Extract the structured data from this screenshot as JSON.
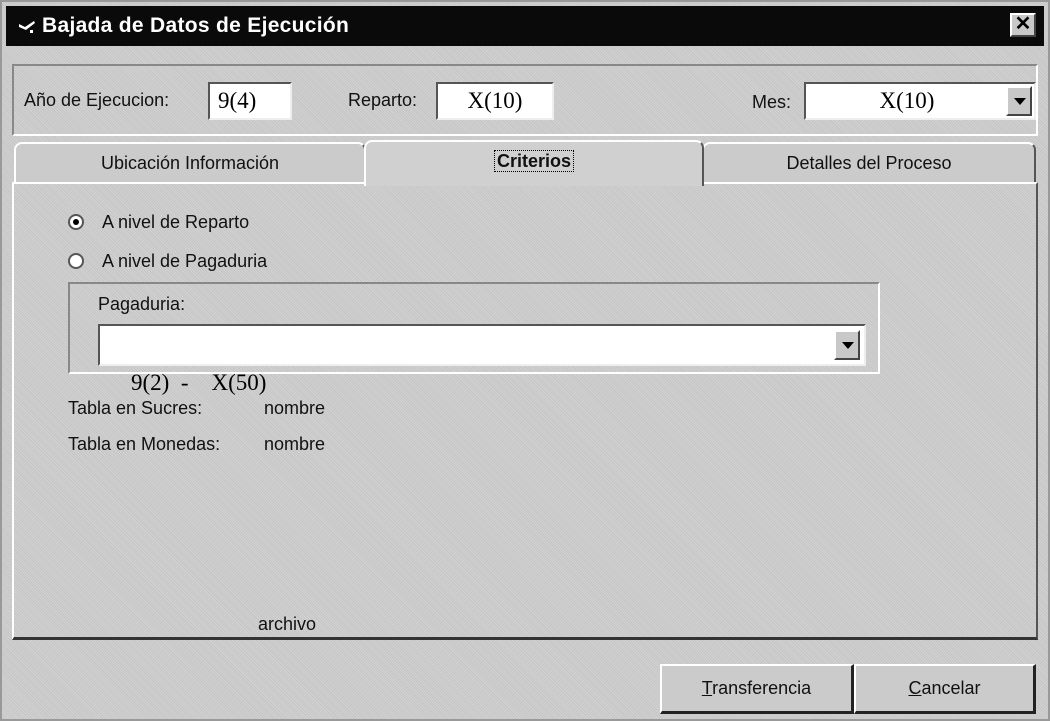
{
  "window": {
    "title": "Bajada de Datos de Ejecución",
    "close_glyph": "✕"
  },
  "header": {
    "anio_label": "Año de Ejecucion:",
    "anio_value": "9(4)",
    "reparto_label": "Reparto:",
    "reparto_value": "X(10)",
    "mes_label": "Mes:",
    "mes_value": "X(10)"
  },
  "tabs": [
    {
      "label": "Ubicación Información"
    },
    {
      "label": "Criterios"
    },
    {
      "label": "Detalles del Proceso"
    }
  ],
  "criterios": {
    "radio_reparto": "A nivel de Reparto",
    "radio_pagaduria": "A nivel de Pagaduria",
    "selected": "radio_reparto",
    "pagaduria_label": "Pagaduria:",
    "pagaduria_value": "9(2)  -    X(50)",
    "tabla_sucres_label": "Tabla en Sucres:",
    "tabla_sucres_value": "nombre",
    "tabla_monedas_label": "Tabla en Monedas:",
    "tabla_monedas_value": "nombre",
    "archivo_label": "archivo"
  },
  "buttons": {
    "transferencia_accel": "T",
    "transferencia_rest": "ransferencia",
    "cancelar_accel": "C",
    "cancelar_rest": "ancelar"
  }
}
